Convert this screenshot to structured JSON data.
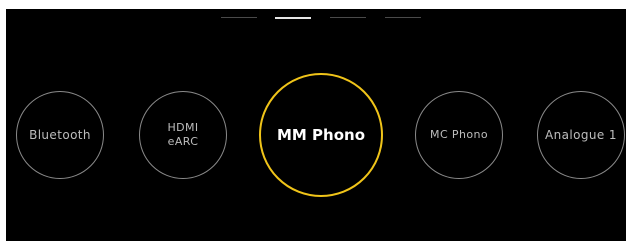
{
  "page_indicator": {
    "count": 4,
    "active_index": 1
  },
  "sources": [
    {
      "label": "Bluetooth",
      "selected": false
    },
    {
      "label": "HDMI\neARC",
      "selected": false
    },
    {
      "label": "MM Phono",
      "selected": true
    },
    {
      "label": "MC Phono",
      "selected": false
    },
    {
      "label": "Analogue 1",
      "selected": false
    }
  ],
  "colors": {
    "background": "#000000",
    "selected_ring": "#f0c419",
    "inactive_ring": "#8a8a8a",
    "inactive_text": "#bdbdbd",
    "selected_text": "#ffffff"
  }
}
